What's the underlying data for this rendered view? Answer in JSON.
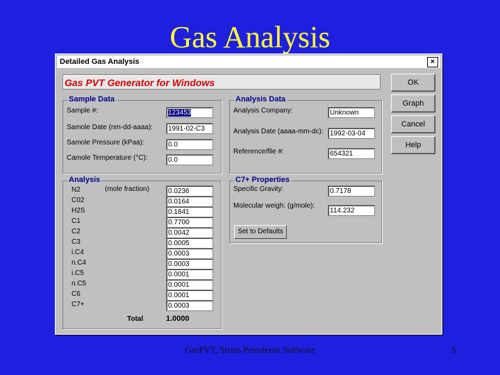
{
  "slide": {
    "title": "Gas Analysis",
    "footer": "GasPVT, Sirius Petroleum Software",
    "page": "5"
  },
  "dialog": {
    "title": "Detailed Gas Analysis",
    "close": "×",
    "banner": "Gas PVT Generator for Windows",
    "buttons": {
      "ok": "OK",
      "graph": "Graph",
      "cancel": "Cancel",
      "help": "Help"
    }
  },
  "sample": {
    "label": "Sample Data",
    "fields": [
      {
        "label": "Sample #:",
        "value": "123453"
      },
      {
        "label": "Samole Date (nm-dd-aaaa):",
        "value": "1991-02-C3"
      },
      {
        "label": "Samole Pressure (kPaa):",
        "value": "0.0"
      },
      {
        "label": "Camole Temperature (°C):",
        "value": "0.0"
      }
    ]
  },
  "analysis_data": {
    "label": "Analysis Data",
    "fields": [
      {
        "label": "Analysis Company:",
        "value": "Unknown"
      },
      {
        "label": "Analysis Date (aaaa-mm-dc):",
        "value": "1992-03-04"
      },
      {
        "label": "Reference/file #:",
        "value": "654321"
      }
    ]
  },
  "analysis": {
    "label": "Analysis",
    "unit": "(mole fraction)",
    "components": [
      {
        "name": "N2",
        "value": "0.0236"
      },
      {
        "name": "C02",
        "value": "0.0164"
      },
      {
        "name": "H2S",
        "value": "0.1841"
      },
      {
        "name": "C1",
        "value": "0.7700"
      },
      {
        "name": "C2",
        "value": "0.0042"
      },
      {
        "name": "C3",
        "value": "0.0005"
      },
      {
        "name": "i.C4",
        "value": "0.0003"
      },
      {
        "name": "n.C4",
        "value": "0.0003"
      },
      {
        "name": "i.C5",
        "value": "0.0001"
      },
      {
        "name": "n.C5",
        "value": "0.0001"
      },
      {
        "name": "C6",
        "value": "0.0001"
      },
      {
        "name": "C7+",
        "value": "0.0003"
      }
    ],
    "total_label": "Total",
    "total_value": "1.0000"
  },
  "c7": {
    "label": "C7+ Properties",
    "fields": [
      {
        "label": "Specific Gravity:",
        "value": "0.7178"
      },
      {
        "label": "Molecular weigh: (g/mole):",
        "value": "114.232"
      }
    ],
    "defaults_button": "Set to Defaults"
  }
}
